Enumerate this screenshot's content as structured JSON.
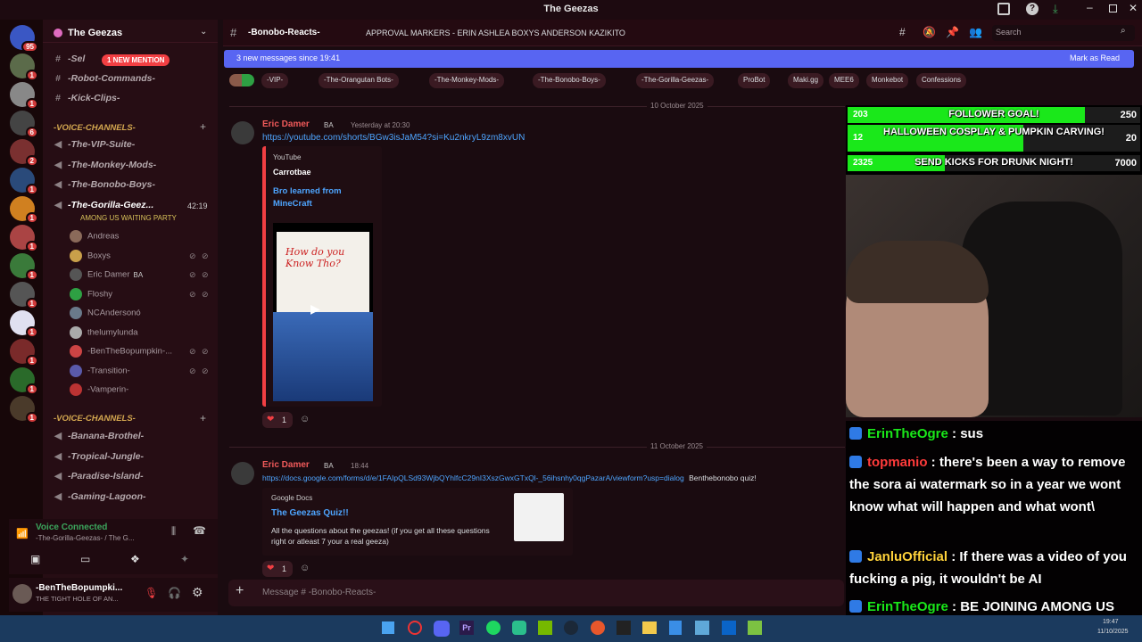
{
  "window": {
    "title": "The Geezas",
    "colors": {
      "accent": "#5865f2",
      "mention": "#f23f43",
      "brand_bg": "#1a0b10"
    }
  },
  "sidebar": {
    "server_name": "The Geezas",
    "text_channels": [
      {
        "label": "-Sel",
        "mention_badge": "1 NEW MENTION"
      },
      {
        "label": "-Robot-Commands-"
      },
      {
        "label": "-Kick-Clips-"
      }
    ],
    "voice_category": "-VOICE-CHANNELS-",
    "voice_channels": [
      {
        "label": "-The-VIP-Suite-"
      },
      {
        "label": "-The-Monkey-Mods-"
      },
      {
        "label": "-The-Bonobo-Boys-"
      },
      {
        "label": "-The-Gorilla-Geez...",
        "time": "42:19",
        "status": "AMONG US WAITING PARTY"
      }
    ],
    "voice_users": [
      {
        "name": "Andreas"
      },
      {
        "name": "Boxys"
      },
      {
        "name": "Eric Damer",
        "tag": "BA"
      },
      {
        "name": "Floshy"
      },
      {
        "name": "NCAndersonó"
      },
      {
        "name": "thelumylunda"
      },
      {
        "name": "-BenTheBopumpkin-..."
      },
      {
        "name": "-Transition-"
      },
      {
        "name": "-Vamperin-"
      }
    ],
    "voice_category_2": "-VOICE-CHANNELS-",
    "voice_channels_2": [
      {
        "label": "-Banana-Brothel-"
      },
      {
        "label": "-Tropical-Jungle-"
      },
      {
        "label": "-Paradise-Island-"
      },
      {
        "label": "-Gaming-Lagoon-"
      }
    ],
    "voice_connected": {
      "label": "Voice Connected",
      "channel": "-The-Gorilla-Geezas- / The G..."
    },
    "user_panel": {
      "name": "-BenTheBopumpki...",
      "status": "THE TIGHT HOLE OF AN..."
    }
  },
  "servers": [
    {
      "badge": "95"
    },
    {
      "badge": "1"
    },
    {
      "badge": "1"
    },
    {
      "badge": "6"
    },
    {
      "badge": "2"
    },
    {
      "badge": "1"
    },
    {
      "badge": "1"
    },
    {
      "badge": "1"
    },
    {
      "badge": "1"
    },
    {
      "badge": "1"
    },
    {
      "badge": "1"
    },
    {
      "badge": "1"
    },
    {
      "badge": "1"
    },
    {
      "badge": "1"
    }
  ],
  "header": {
    "channel_name": "-Bonobo-Reacts-",
    "topic": "APPROVAL MARKERS - ERIN ASHLEA BOXYS ANDERSON KAZIKITO",
    "search_placeholder": "Search"
  },
  "banner": {
    "text": "3 new messages since 19:41",
    "action": "Mark as Read"
  },
  "pills": [
    "-VIP-",
    "-The-Orangutan Bots-",
    "-The-Monkey-Mods-",
    "-The-Bonobo-Boys-",
    "-The-Gorilla-Geezas-",
    "ProBot",
    "Maki.gg",
    "MEE6",
    "Monkebot",
    "Confessions"
  ],
  "messages": [
    {
      "date": "10 October 2025",
      "author": "Eric Damer",
      "tag": "BA",
      "timestamp": "Yesterday at 20:30",
      "link": "https://youtube.com/shorts/BGw3isJaM54?si=Ku2nkryL9zm8xvUN",
      "embed": {
        "provider": "YouTube",
        "channel": "Carrotbae",
        "title": "Bro learned from MineCraft",
        "thumb_text": "How do you Know Tho?"
      },
      "reaction_count": "1"
    },
    {
      "date": "11 October 2025",
      "author": "Eric Damer",
      "tag": "BA",
      "timestamp": "18:44",
      "link": "https://docs.google.com/forms/d/e/1FAIpQLSd93WjbQYhlfcC29nI3XszGwxGTxQl-_56ihsnhy0qgPazarA/viewform?usp=dialog",
      "link_suffix": "Benthebonobo quiz!",
      "embed": {
        "provider": "Google Docs",
        "title": "The Geezas Quiz!!",
        "description": "All the questions about the geezas! (if you get all these questions right or atleast 7 your a real geeza)"
      },
      "reaction_count": "1"
    }
  ],
  "composer": {
    "placeholder": "Message # -Bonobo-Reacts-"
  },
  "goals": [
    {
      "current": "203",
      "label": "FOLLOWER GOAL!",
      "target": "250",
      "progress": 0.812
    },
    {
      "current": "12",
      "label": "HALLOWEEN COSPLAY & PUMPKIN CARVING!",
      "target": "20",
      "progress": 0.6
    },
    {
      "current": "2325",
      "label": "SEND KICKS FOR DRUNK NIGHT!",
      "target": "7000",
      "progress": 0.332
    }
  ],
  "twitch_chat": [
    {
      "user": "ErinTheOgre",
      "color": "#1ae81a",
      "text": " : sus"
    },
    {
      "user": "topmanio",
      "color": "#ff3b3b",
      "text": " : there's been a way to remove the sora ai watermark so in a year we wont know what will happen and what wont\\"
    },
    {
      "user": "JanluOfficial",
      "color": "#ffd23b",
      "text": " : If there was a video of you fucking a pig, it wouldn't be AI"
    },
    {
      "user": "ErinTheOgre",
      "color": "#1ae81a",
      "text": " : BE JOINING AMONG US WAITING PARTY VC"
    }
  ],
  "taskbar": {
    "time": "19:47",
    "date": "11/10/2025"
  }
}
